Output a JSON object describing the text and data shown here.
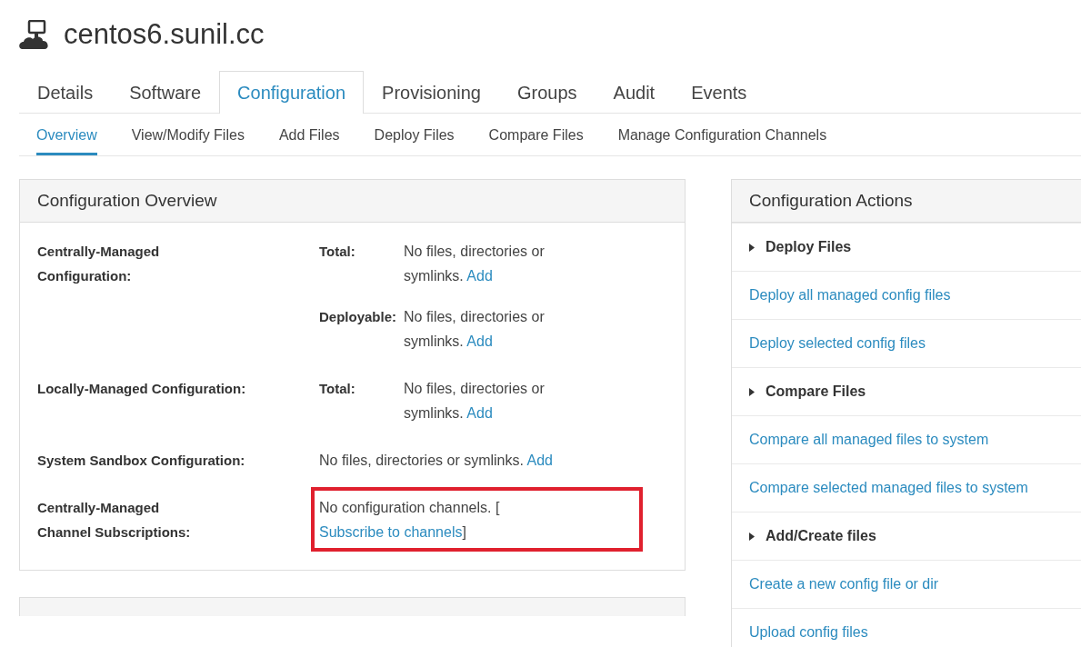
{
  "header": {
    "title": "centos6.sunil.cc"
  },
  "tabs": [
    {
      "label": "Details",
      "selected": false
    },
    {
      "label": "Software",
      "selected": false
    },
    {
      "label": "Configuration",
      "selected": true
    },
    {
      "label": "Provisioning",
      "selected": false
    },
    {
      "label": "Groups",
      "selected": false
    },
    {
      "label": "Audit",
      "selected": false
    },
    {
      "label": "Events",
      "selected": false
    }
  ],
  "subtabs": [
    {
      "label": "Overview",
      "selected": true
    },
    {
      "label": "View/Modify Files",
      "selected": false
    },
    {
      "label": "Add Files",
      "selected": false
    },
    {
      "label": "Deploy Files",
      "selected": false
    },
    {
      "label": "Compare Files",
      "selected": false
    },
    {
      "label": "Manage Configuration Channels",
      "selected": false
    }
  ],
  "overview": {
    "title": "Configuration Overview",
    "rows": [
      {
        "label": "Centrally-Managed Configuration:",
        "highlighted": false,
        "entries": [
          {
            "key": "Total:",
            "text": "No files, directories or symlinks.",
            "link": "Add"
          },
          {
            "key": "Deployable:",
            "text": "No files, directories or symlinks.",
            "link": "Add"
          }
        ]
      },
      {
        "label": "Locally-Managed Configuration:",
        "highlighted": false,
        "entries": [
          {
            "key": "Total:",
            "text": "No files, directories or symlinks.",
            "link": "Add"
          }
        ]
      },
      {
        "label": "System Sandbox Configuration:",
        "highlighted": false,
        "entries": [
          {
            "text": "No files, directories or symlinks.",
            "link": "Add"
          }
        ]
      },
      {
        "label": "Centrally-Managed Channel Subscriptions:",
        "highlighted": true,
        "entries": [
          {
            "text": "No configuration channels. [",
            "link": "Subscribe to channels",
            "suffix": "]"
          }
        ]
      }
    ]
  },
  "actions": {
    "title": "Configuration Actions",
    "items": [
      {
        "kind": "heading",
        "label": "Deploy Files"
      },
      {
        "kind": "link",
        "label": "Deploy all managed config files"
      },
      {
        "kind": "link",
        "label": "Deploy selected config files"
      },
      {
        "kind": "heading",
        "label": "Compare Files"
      },
      {
        "kind": "link",
        "label": "Compare all managed files to system"
      },
      {
        "kind": "link",
        "label": "Compare selected managed files to system"
      },
      {
        "kind": "heading",
        "label": "Add/Create files"
      },
      {
        "kind": "link",
        "label": "Create a new config file or dir"
      },
      {
        "kind": "link",
        "label": "Upload config files"
      }
    ]
  }
}
